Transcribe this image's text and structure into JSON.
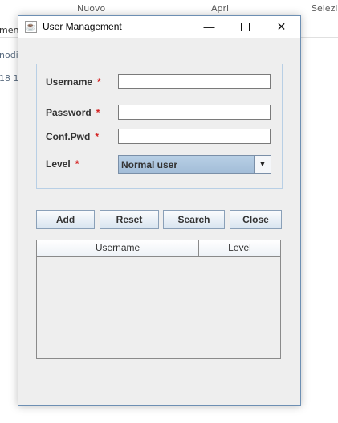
{
  "background": {
    "header_items": [
      "Nuovo",
      "Apri",
      "Selezi"
    ],
    "partial_texts": [
      "ment",
      "nodif",
      "18 1"
    ]
  },
  "dialog": {
    "title": "User Management",
    "title_icon": "java-icon",
    "controls": {
      "minimize": "—",
      "close": "✕"
    },
    "form": {
      "username_label": "Username",
      "password_label": "Password",
      "confpwd_label": "Conf.Pwd",
      "level_label": "Level",
      "required_mark": "*",
      "username_value": "",
      "password_value": "",
      "confpwd_value": "",
      "level_value": "Normal user",
      "dropdown_arrow": "▼"
    },
    "buttons": {
      "add": "Add",
      "reset": "Reset",
      "search": "Search",
      "close": "Close"
    },
    "table": {
      "columns": [
        "Username",
        "Level"
      ],
      "rows": []
    }
  }
}
